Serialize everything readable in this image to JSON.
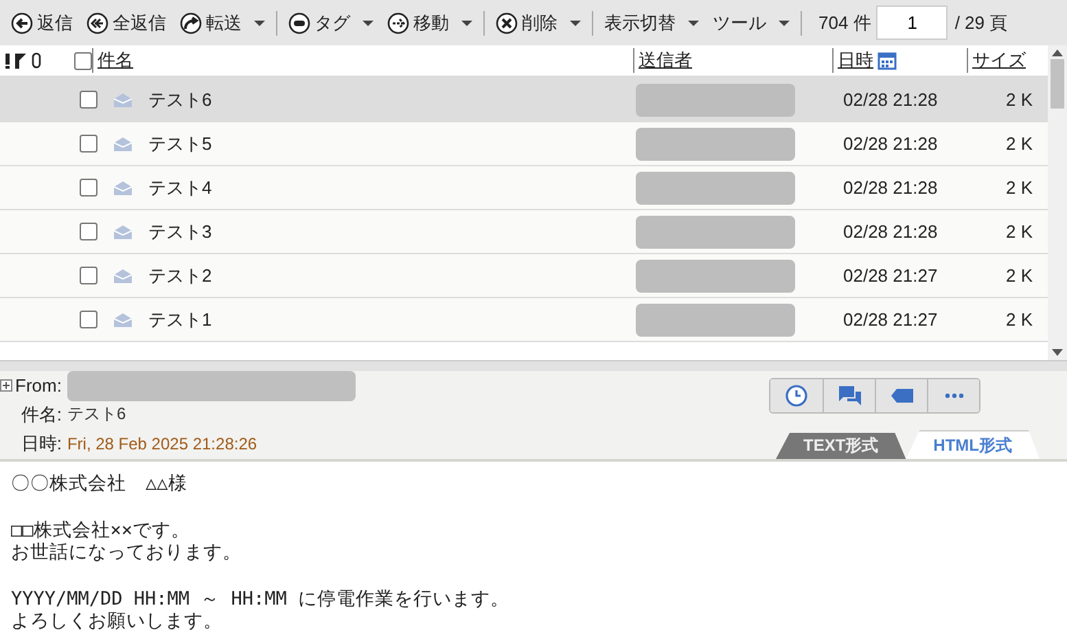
{
  "toolbar": {
    "groups": [
      [
        {
          "label": "返信",
          "dropdown": false
        },
        {
          "label": "全返信",
          "dropdown": false
        },
        {
          "label": "転送",
          "dropdown": true
        }
      ],
      [
        {
          "label": "タグ",
          "dropdown": true
        },
        {
          "label": "移動",
          "dropdown": true
        }
      ],
      [
        {
          "label": "削除",
          "dropdown": true
        }
      ],
      [
        {
          "label": "表示切替",
          "dropdown": true
        },
        {
          "label": "ツール",
          "dropdown": true
        }
      ]
    ],
    "count": "704 件",
    "page": "1",
    "pages": "/ 29 頁"
  },
  "table": {
    "all_checked": false,
    "columns": [
      "件名",
      "送信者",
      "日時",
      "サイズ"
    ],
    "rows": [
      {
        "subject": "テスト6",
        "date": "02/28 21:28",
        "size": "2 K",
        "selected": true,
        "checked": false
      },
      {
        "subject": "テスト5",
        "date": "02/28 21:28",
        "size": "2 K",
        "selected": false,
        "checked": false
      },
      {
        "subject": "テスト4",
        "date": "02/28 21:28",
        "size": "2 K",
        "selected": false,
        "checked": false
      },
      {
        "subject": "テスト3",
        "date": "02/28 21:28",
        "size": "2 K",
        "selected": false,
        "checked": false
      },
      {
        "subject": "テスト2",
        "date": "02/28 21:27",
        "size": "2 K",
        "selected": false,
        "checked": false
      },
      {
        "subject": "テスト1",
        "date": "02/28 21:27",
        "size": "2 K",
        "selected": false,
        "checked": false
      }
    ]
  },
  "preview": {
    "from_label": "From:",
    "subject_label": "件名:",
    "subject": "テスト6",
    "date_label": "日時:",
    "date": "Fri, 28 Feb 2025 21:28:26",
    "tabs": [
      {
        "label": "TEXT形式",
        "selected": false
      },
      {
        "label": "HTML形式",
        "selected": true
      }
    ],
    "body": [
      [
        "〇〇株式会社　△△様"
      ],
      [
        "□□株式会社××です。",
        "お世話になっております。"
      ],
      [
        "YYYY/MM/DD HH:MM ～ HH:MM に停電作業を行います。",
        "よろしくお願いします。"
      ]
    ]
  }
}
